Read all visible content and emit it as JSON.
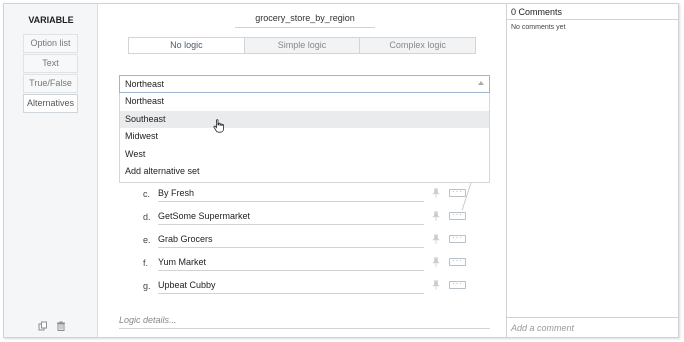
{
  "left_panel": {
    "title": "VARIABLE",
    "types": [
      "Option list",
      "Text",
      "True/False",
      "Alternatives"
    ],
    "active_type": "Alternatives",
    "icons": [
      "copy-icon",
      "trash-icon"
    ]
  },
  "question": {
    "name": "grocery_store_by_region"
  },
  "logic_tabs": [
    "No logic",
    "Simple logic",
    "Complex logic"
  ],
  "active_logic_tab": "No logic",
  "alternative_select": {
    "value": "Northeast",
    "options": [
      "Northeast",
      "Southeast",
      "Midwest",
      "West",
      "Add alternative set"
    ],
    "hovered": "Southeast"
  },
  "alternatives": [
    {
      "letter": "c.",
      "value": "By Fresh"
    },
    {
      "letter": "d.",
      "value": "GetSome Supermarket"
    },
    {
      "letter": "e.",
      "value": "Grab Grocers"
    },
    {
      "letter": "f.",
      "value": "Yum Market"
    },
    {
      "letter": "g.",
      "value": "Upbeat Cubby"
    }
  ],
  "logic_details_placeholder": "Logic details...",
  "comments": {
    "count_label": "0 Comments",
    "empty_text": "No comments yet",
    "add_placeholder": "Add a comment"
  }
}
